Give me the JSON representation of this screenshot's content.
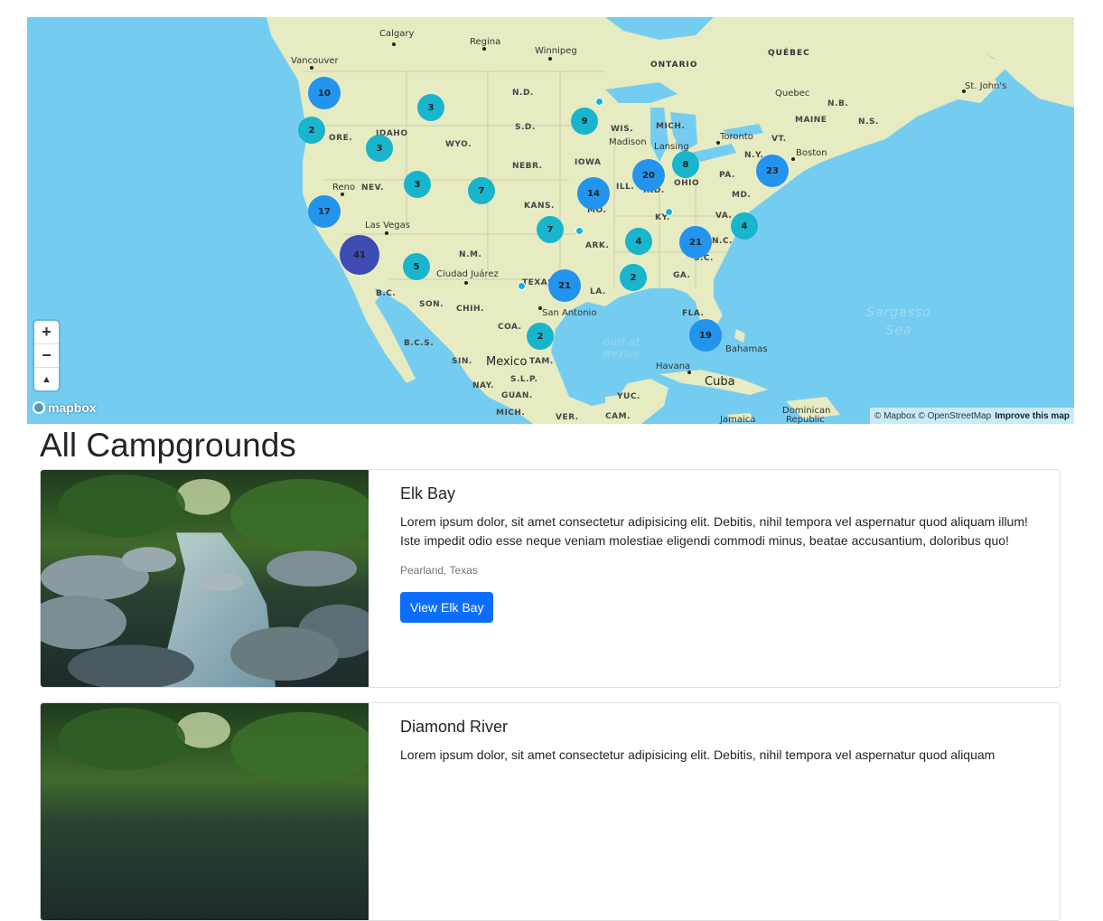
{
  "map": {
    "attribution": "© Mapbox © OpenStreetMap",
    "improve": "Improve this map",
    "logo": "mapbox",
    "controls": {
      "zoom_in": "+",
      "zoom_out": "−",
      "compass": "▲"
    },
    "colors": {
      "water": "#74cdf0",
      "land": "#e9ecc4",
      "cluster_small": "#19b5cd",
      "cluster_medium": "#2394ee",
      "cluster_large": "#3e4cb3",
      "point": "#11b4da"
    },
    "labels": {
      "calgary": "Calgary",
      "regina": "Regina",
      "winnipeg": "Winnipeg",
      "ontario": "ONTARIO",
      "quebec_prov": "QUÉBEC",
      "quebec_city": "Quebec",
      "st_johns": "St. John's",
      "vancouver": "Vancouver",
      "nd": "N.D.",
      "sd": "S.D.",
      "idaho": "IDAHO",
      "ore": "ORE.",
      "wyo": "WYO.",
      "wis": "WIS.",
      "mich": "MICH.",
      "madison": "Madison",
      "lansing": "Lansing",
      "toronto": "Toronto",
      "vt": "VT.",
      "maine": "MAINE",
      "nb": "N.B.",
      "ns": "N.S.",
      "ny": "N.Y.",
      "boston": "Boston",
      "pa": "PA.",
      "ohio": "OHIO",
      "iowa": "IOWA",
      "nebr": "NEBR.",
      "nev": "NEV.",
      "reno": "Reno",
      "ill": "ILL.",
      "ind": "IND.",
      "md": "MD.",
      "kans": "KANS.",
      "mo": "MO.",
      "ky": "KY.",
      "va": "VA.",
      "nc": "N.C.",
      "sc": "S.C.",
      "lasvegas": "Las Vegas",
      "ark": "ARK.",
      "nm": "N.M.",
      "ciudad": "Ciudad Juárez",
      "texas": "TEXAS",
      "la": "LA.",
      "ga": "GA.",
      "bc": "B.C.",
      "son": "SON.",
      "chih": "CHIH.",
      "sanantonio": "San Antonio",
      "coa": "COA.",
      "fla": "FLA.",
      "bcs": "B.C.S.",
      "sin": "SIN.",
      "mexico": "Mexico",
      "tam": "TAM.",
      "slp": "S.L.P.",
      "nay": "NAY.",
      "guan": "GUAN.",
      "mich_mx": "MICH.",
      "ver": "VER.",
      "yuc": "YUC.",
      "cam": "CAM.",
      "havana": "Havana",
      "cuba": "Cuba",
      "bahamas": "Bahamas",
      "jamaica": "Jamaica",
      "dominican": "Dominican",
      "republic": "Republic",
      "gulf1": "Gulf of",
      "gulf2": "Mexico",
      "sargasso1": "Sargasso",
      "sargasso2": "Sea"
    },
    "clusters": [
      {
        "id": "c10",
        "count": "10"
      },
      {
        "id": "c3a",
        "count": "3"
      },
      {
        "id": "c2a",
        "count": "2"
      },
      {
        "id": "c3b",
        "count": "3"
      },
      {
        "id": "c9",
        "count": "9"
      },
      {
        "id": "c20",
        "count": "20"
      },
      {
        "id": "c8",
        "count": "8"
      },
      {
        "id": "c23",
        "count": "23"
      },
      {
        "id": "c3c",
        "count": "3"
      },
      {
        "id": "c7a",
        "count": "7"
      },
      {
        "id": "c14",
        "count": "14"
      },
      {
        "id": "c17",
        "count": "17"
      },
      {
        "id": "c7b",
        "count": "7"
      },
      {
        "id": "c4a",
        "count": "4"
      },
      {
        "id": "c21a",
        "count": "21"
      },
      {
        "id": "c4b",
        "count": "4"
      },
      {
        "id": "c41",
        "count": "41"
      },
      {
        "id": "c5",
        "count": "5"
      },
      {
        "id": "c2b",
        "count": "2"
      },
      {
        "id": "c21b",
        "count": "21"
      },
      {
        "id": "c2c",
        "count": "2"
      },
      {
        "id": "c19",
        "count": "19"
      }
    ]
  },
  "page": {
    "title": "All Campgrounds"
  },
  "campgrounds": [
    {
      "title": "Elk Bay",
      "description": "Lorem ipsum dolor, sit amet consectetur adipisicing elit. Debitis, nihil tempora vel aspernatur quod aliquam illum! Iste impedit odio esse neque veniam molestiae eligendi commodi minus, beatae accusantium, doloribus quo!",
      "location": "Pearland, Texas",
      "button": "View Elk Bay"
    },
    {
      "title": "Diamond River",
      "description": "Lorem ipsum dolor, sit amet consectetur adipisicing elit. Debitis, nihil tempora vel aspernatur quod aliquam",
      "location": "",
      "button": ""
    }
  ],
  "theme": {
    "primary": "#0d6efd",
    "text": "#212529",
    "muted": "#6c757d"
  }
}
